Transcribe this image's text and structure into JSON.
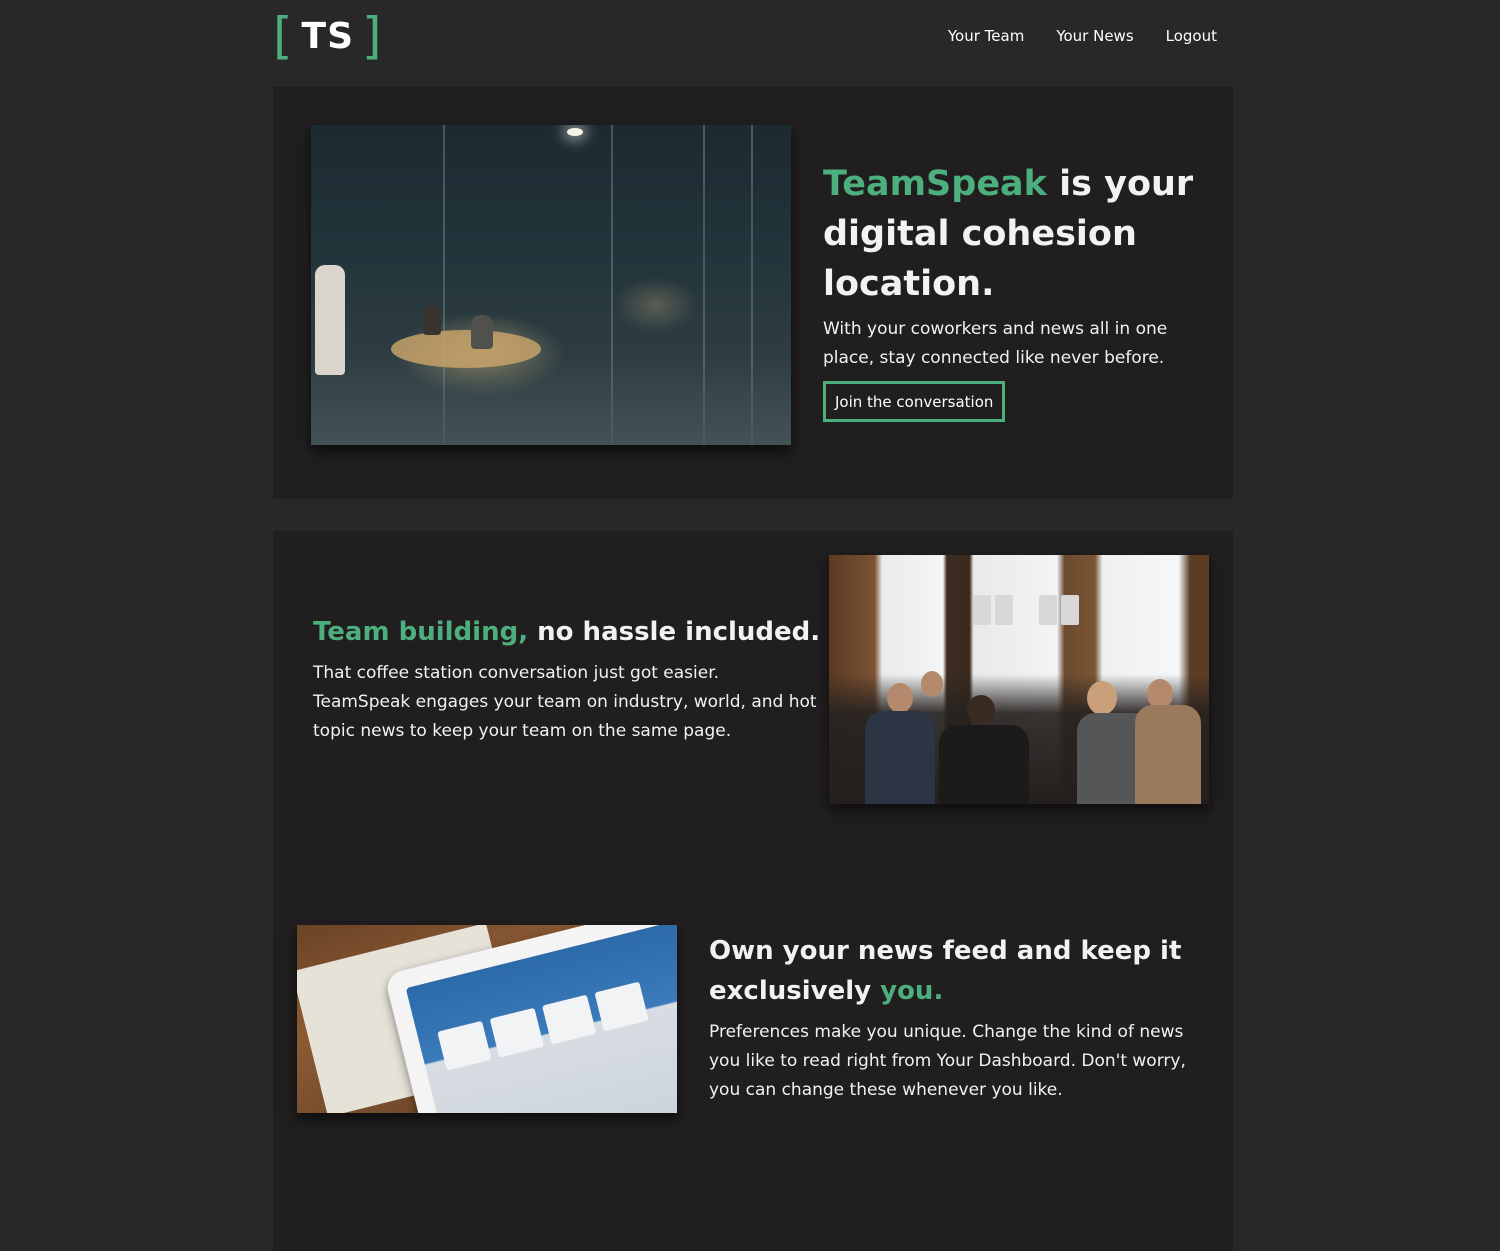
{
  "brand": {
    "logo_left": "[",
    "logo_text": "TS",
    "logo_right": "]",
    "accent_color": "#4caf7d"
  },
  "nav": {
    "items": [
      {
        "label": "Your Team"
      },
      {
        "label": "Your News"
      },
      {
        "label": "Logout"
      }
    ]
  },
  "hero": {
    "title_highlight": "TeamSpeak",
    "title_rest": " is your digital cohesion location.",
    "body": "With your coworkers and news all in one place, stay connected like never before.",
    "cta_label": "Join the conversation"
  },
  "team_section": {
    "title_highlight": "Team building,",
    "title_rest": " no hassle included.",
    "body": "That coffee station conversation just got easier. TeamSpeak engages your team on industry, world, and hot topic news to keep your team on the same page."
  },
  "news_section": {
    "title_rest": "Own your news feed and keep it exclusively ",
    "title_highlight": "you.",
    "body": "Preferences make you unique. Change the kind of news you like to read right from Your Dashboard. Don't worry, you can change these whenever you like."
  }
}
